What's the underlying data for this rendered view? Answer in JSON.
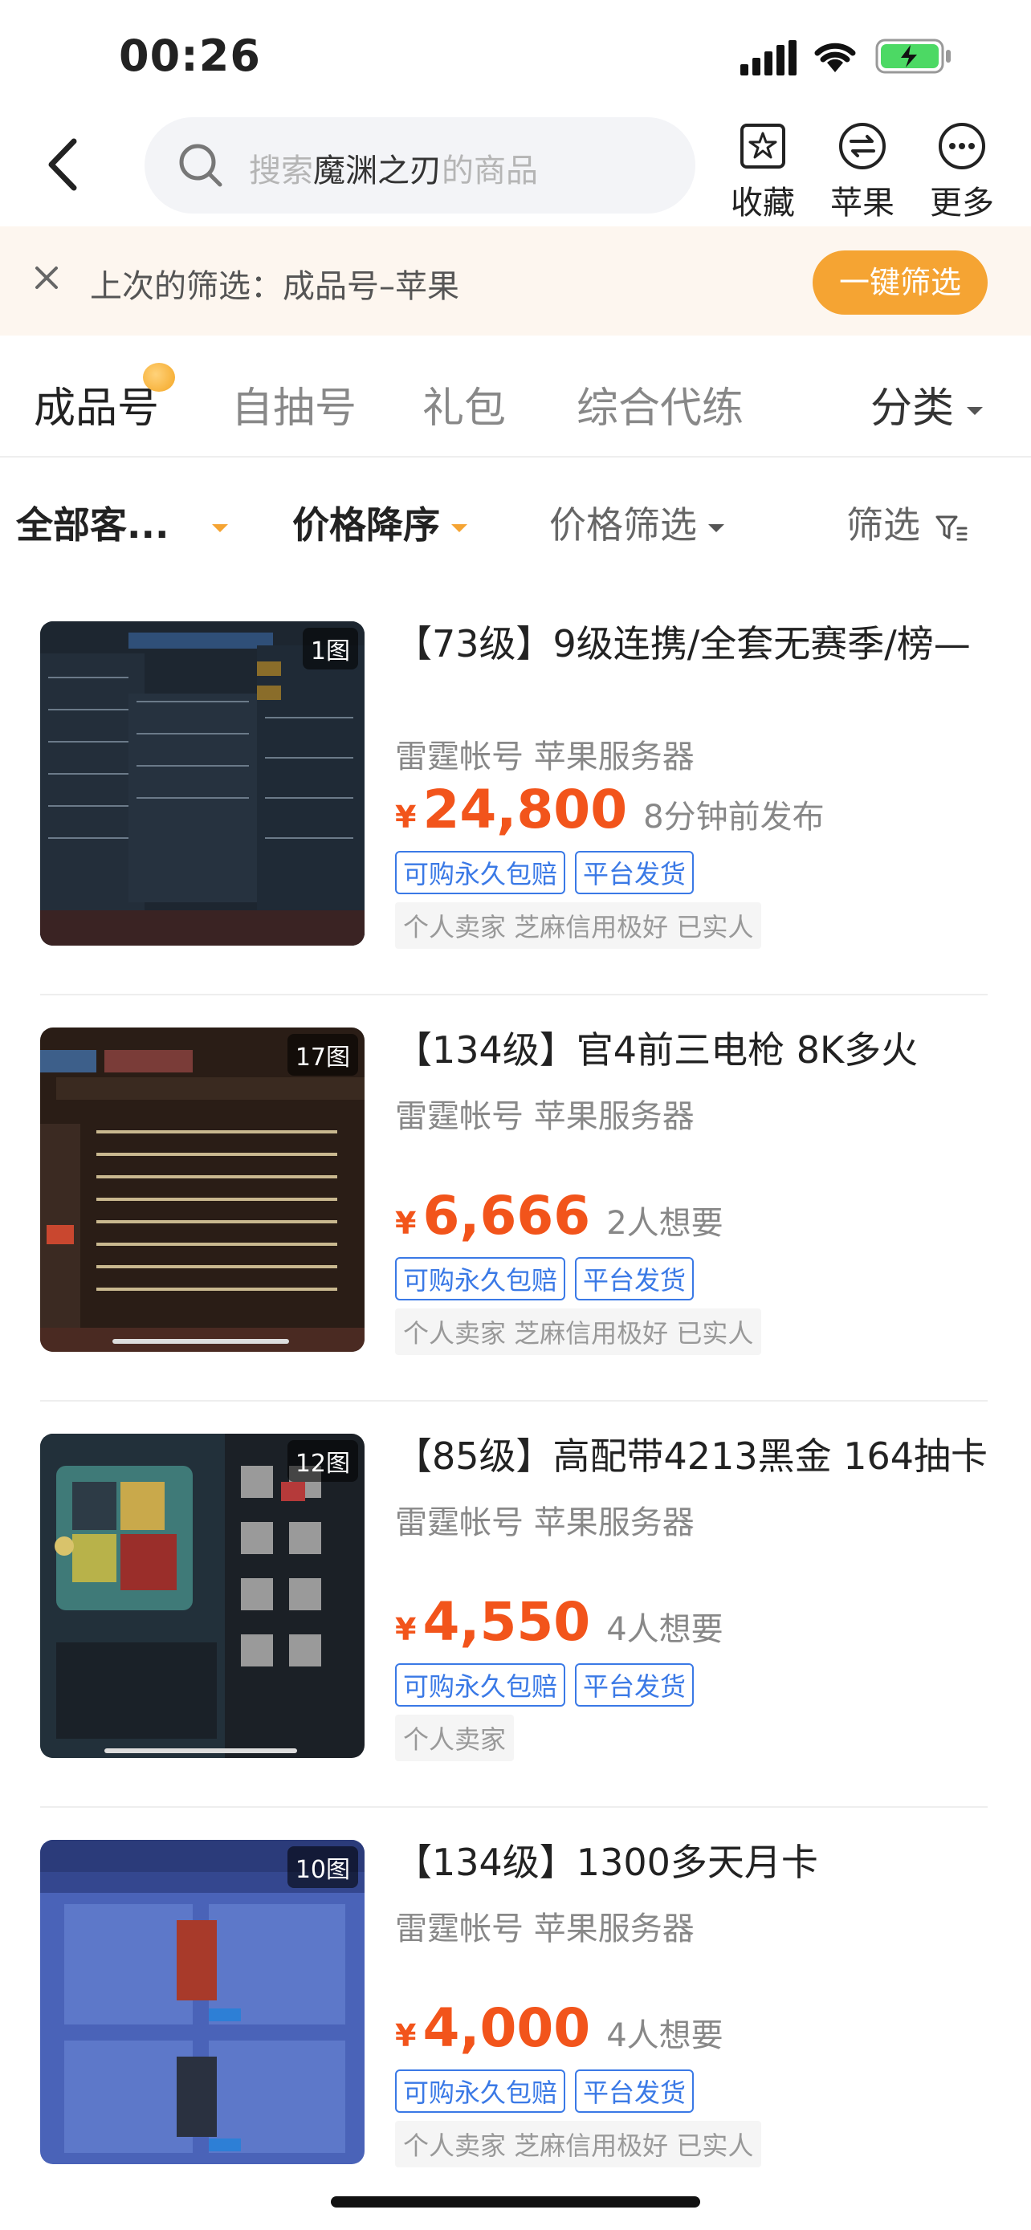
{
  "status": {
    "time": "00:26"
  },
  "search": {
    "prefix": "搜索",
    "keyword": "魔渊之刃",
    "suffix": "的商品"
  },
  "header": {
    "fav_label": "收藏",
    "apple_label": "苹果",
    "more_label": "更多"
  },
  "notice": {
    "text": "上次的筛选：成品号–苹果",
    "button": "一键筛选"
  },
  "tabs": {
    "items": [
      "成品号",
      "自抽号",
      "礼包",
      "综合代练"
    ],
    "category": "分类"
  },
  "sortbar": {
    "all": "全部客...",
    "price_desc": "价格降序",
    "price_filter": "价格筛选",
    "filter": "筛选"
  },
  "listings": [
    {
      "img_count": "1图",
      "title": "【73级】9级连携/全套无赛季/榜—",
      "sub": "雷霆帐号 苹果服务器",
      "currency": "¥",
      "price": "24,800",
      "meta": "8分钟前发布",
      "tags": [
        "可购永久包赔",
        "平台发货"
      ],
      "seller": "个人卖家 芝麻信用极好 已实人"
    },
    {
      "img_count": "17图",
      "title": "【134级】官4前三电枪 8K多火",
      "sub": "雷霆帐号 苹果服务器",
      "currency": "¥",
      "price": "6,666",
      "meta": "2人想要",
      "tags": [
        "可购永久包赔",
        "平台发货"
      ],
      "seller": "个人卖家 芝麻信用极好 已实人"
    },
    {
      "img_count": "12图",
      "title": "【85级】高配带4213黑金 164抽卡",
      "sub": "雷霆帐号 苹果服务器",
      "currency": "¥",
      "price": "4,550",
      "meta": "4人想要",
      "tags": [
        "可购永久包赔",
        "平台发货"
      ],
      "seller": "个人卖家"
    },
    {
      "img_count": "10图",
      "title": "【134级】1300多天月卡",
      "sub": "雷霆帐号 苹果服务器",
      "currency": "¥",
      "price": "4,000",
      "meta": "4人想要",
      "tags": [
        "可购永久包赔",
        "平台发货"
      ],
      "seller": "个人卖家 芝麻信用极好 已实人"
    }
  ],
  "colors": {
    "accent": "#f5a433",
    "price": "#f2541b",
    "tag_blue": "#3a79e6"
  }
}
